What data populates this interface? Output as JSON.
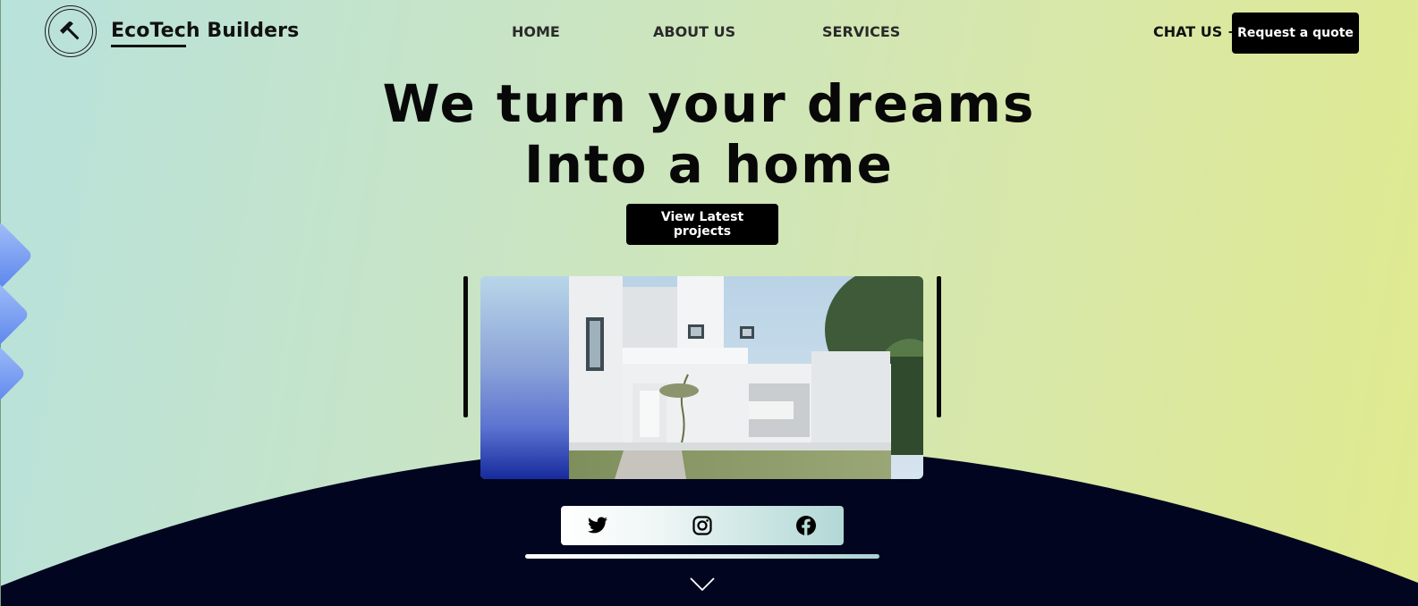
{
  "brand": {
    "name": "EcoTech Builders",
    "logo_icon": "hammer-icon"
  },
  "nav": {
    "items": [
      {
        "label": "HOME"
      },
      {
        "label": "ABOUT US"
      },
      {
        "label": "SERVICES"
      }
    ],
    "chat_label": "CHAT US +",
    "cta_label": "Request a quote"
  },
  "hero": {
    "title_line1": "We turn your dreams",
    "title_line2": "Into a home",
    "button_label": "View Latest projects"
  },
  "social": {
    "icons": [
      "twitter-icon",
      "instagram-icon",
      "facebook-icon"
    ]
  },
  "scroll_icon": "chevron-down-icon",
  "colors": {
    "background_gradient": [
      "#b8e2dc",
      "#c6e4c8",
      "#d6e7ae",
      "#e0ea8e"
    ],
    "dark_section": "#010520",
    "button": "#000000",
    "button_text": "#ffffff",
    "decoration": "#5a84ec"
  }
}
